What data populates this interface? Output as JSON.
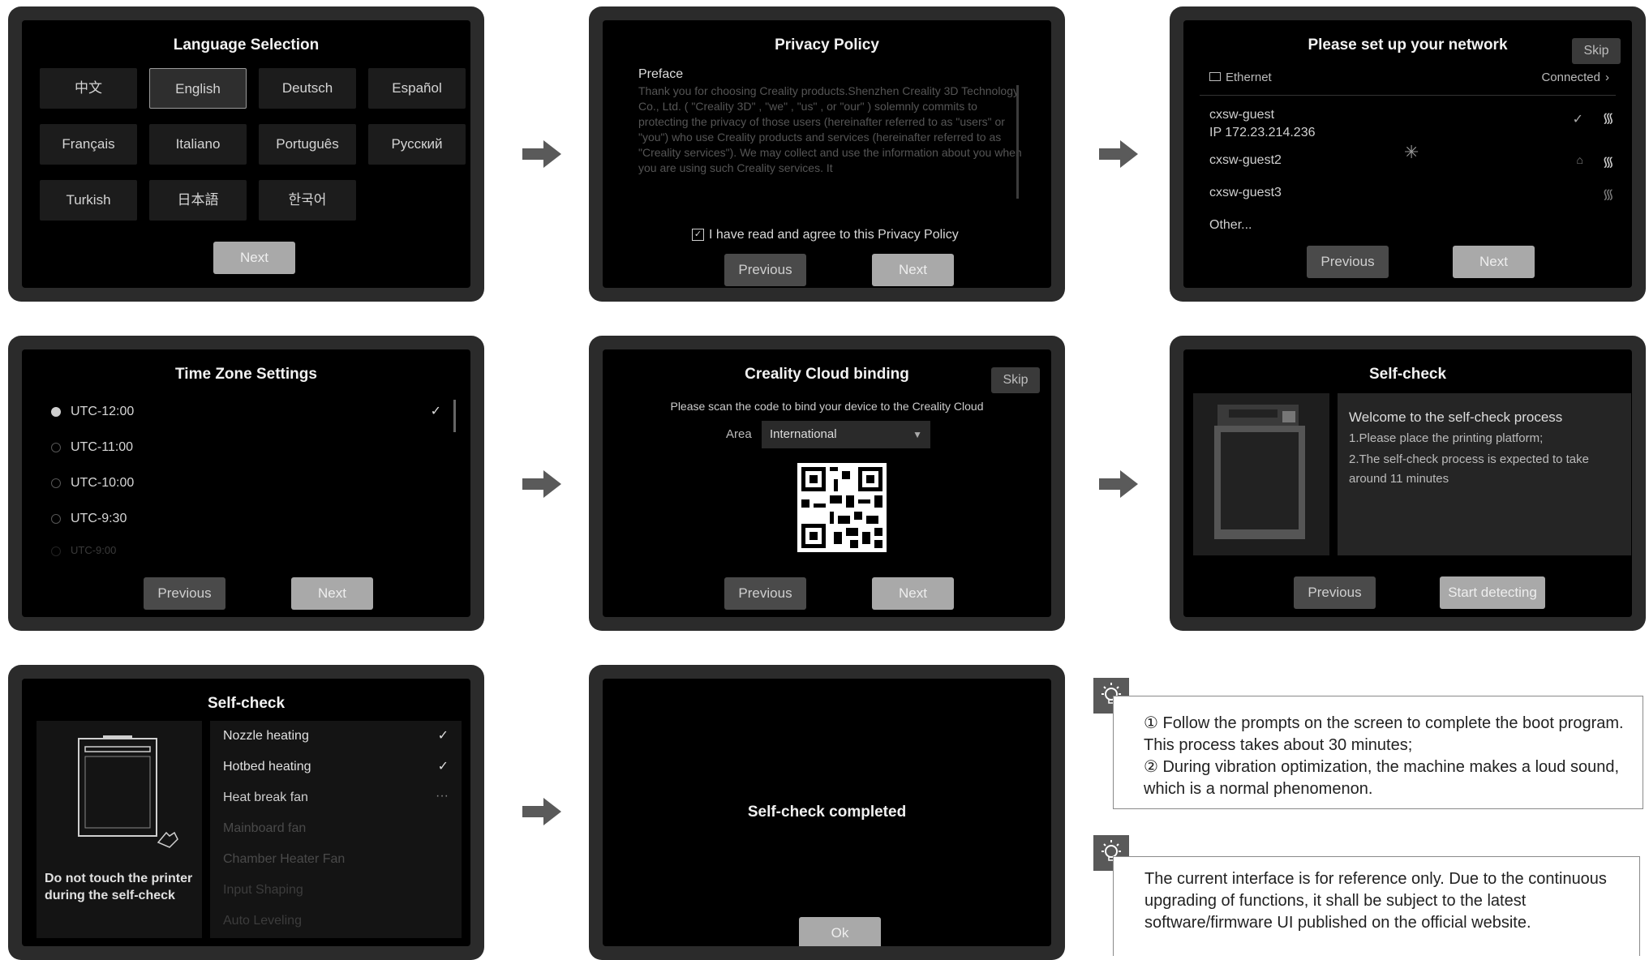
{
  "lang": {
    "title": "Language Selection",
    "options": [
      "中文",
      "English",
      "Deutsch",
      "Español",
      "Français",
      "Italiano",
      "Português",
      "Русский",
      "Turkish",
      "日本語",
      "한국어"
    ],
    "next": "Next"
  },
  "privacy": {
    "title": "Privacy Policy",
    "preface": "Preface",
    "body": "Thank you for choosing Creality products.Shenzhen Creality 3D Technology Co., Ltd. ( \"Creality 3D\" , \"we\" , \"us\" , or \"our\" ) solemnly commits to protecting the privacy of those users (hereinafter referred to as \"users\" or \"you\") who use Creality products and services (hereinafter referred to as \"Creality services\"). We may collect and use the information about you when you are using such Creality services. It",
    "agree": "I have read and agree to this Privacy Policy",
    "previous": "Previous",
    "next": "Next"
  },
  "network": {
    "title": "Please set up your network",
    "skip": "Skip",
    "ethernet": "Ethernet",
    "ethernet_status": "Connected",
    "networks": [
      {
        "ssid": "cxsw-guest",
        "ip": "IP 172.23.214.236"
      },
      {
        "ssid": "cxsw-guest2"
      },
      {
        "ssid": "cxsw-guest3"
      }
    ],
    "other": "Other...",
    "previous": "Previous",
    "next": "Next"
  },
  "timezone": {
    "title": "Time Zone Settings",
    "zones": [
      "UTC-12:00",
      "UTC-11:00",
      "UTC-10:00",
      "UTC-9:30",
      "UTC-9:00"
    ],
    "previous": "Previous",
    "next": "Next"
  },
  "cloud": {
    "title": "Creality Cloud binding",
    "skip": "Skip",
    "instruction": "Please scan the code to bind your device to the Creality Cloud",
    "area_label": "Area",
    "area_value": "International",
    "previous": "Previous",
    "next": "Next"
  },
  "selfcheck_intro": {
    "title": "Self-check",
    "welcome": "Welcome to the self-check process",
    "step1": "1.Please place the printing platform;",
    "step2": "2.The self-check process is expected to take around 11 minutes",
    "previous": "Previous",
    "start": "Start detecting"
  },
  "selfcheck_run": {
    "title": "Self-check",
    "warning": "Do not touch the printer during the self-check",
    "items": [
      "Nozzle heating",
      "Hotbed heating",
      "Heat break fan",
      "Mainboard fan",
      "Chamber Heater Fan",
      "Input Shaping",
      "Auto Leveling"
    ]
  },
  "selfcheck_done": {
    "message": "Self-check completed",
    "ok": "Ok"
  },
  "tips": {
    "tip1_line1": "① Follow the prompts on the screen to complete the boot program. This process takes about 30 minutes;",
    "tip1_line2": "② During vibration optimization, the machine makes a loud sound, which is a normal phenomenon.",
    "tip2": "The current interface is for reference only. Due to the continuous upgrading of functions, it shall be subject to the latest software/firmware UI published on the official website."
  }
}
